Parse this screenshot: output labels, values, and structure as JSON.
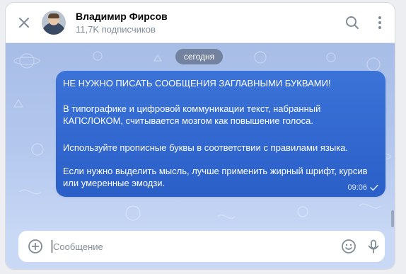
{
  "header": {
    "title": "Владимир Фирсов",
    "subtitle": "11,7K подписчиков",
    "close_icon": "close-icon",
    "search_icon": "search-icon",
    "menu_icon": "more-vertical-icon"
  },
  "chat": {
    "date_label": "сегодня",
    "message": {
      "lines": [
        "НЕ НУЖНО ПИСАТЬ СООБЩЕНИЯ ЗАГЛАВНЫМИ БУКВАМИ!",
        "",
        "В типографике и цифровой коммуникации текст, набранный",
        "КАПСЛОКОМ, считывается мозгом как повышение голоса.",
        "",
        "Используйте прописные буквы в соответствии с правилами языка.",
        "",
        "Если нужно выделить мысль, лучше применить жирный шрифт, курсив",
        "или умеренные эмодзи."
      ],
      "time": "09:06",
      "status_icon": "check-icon"
    }
  },
  "compose": {
    "placeholder": "Сообщение",
    "value": "",
    "add_icon": "plus-circle-icon",
    "emoji_icon": "smile-icon",
    "mic_icon": "microphone-icon"
  },
  "colors": {
    "bubble": "#2f66d0",
    "chat_background": "#b3c7ee",
    "secondary_text": "#818c99"
  }
}
